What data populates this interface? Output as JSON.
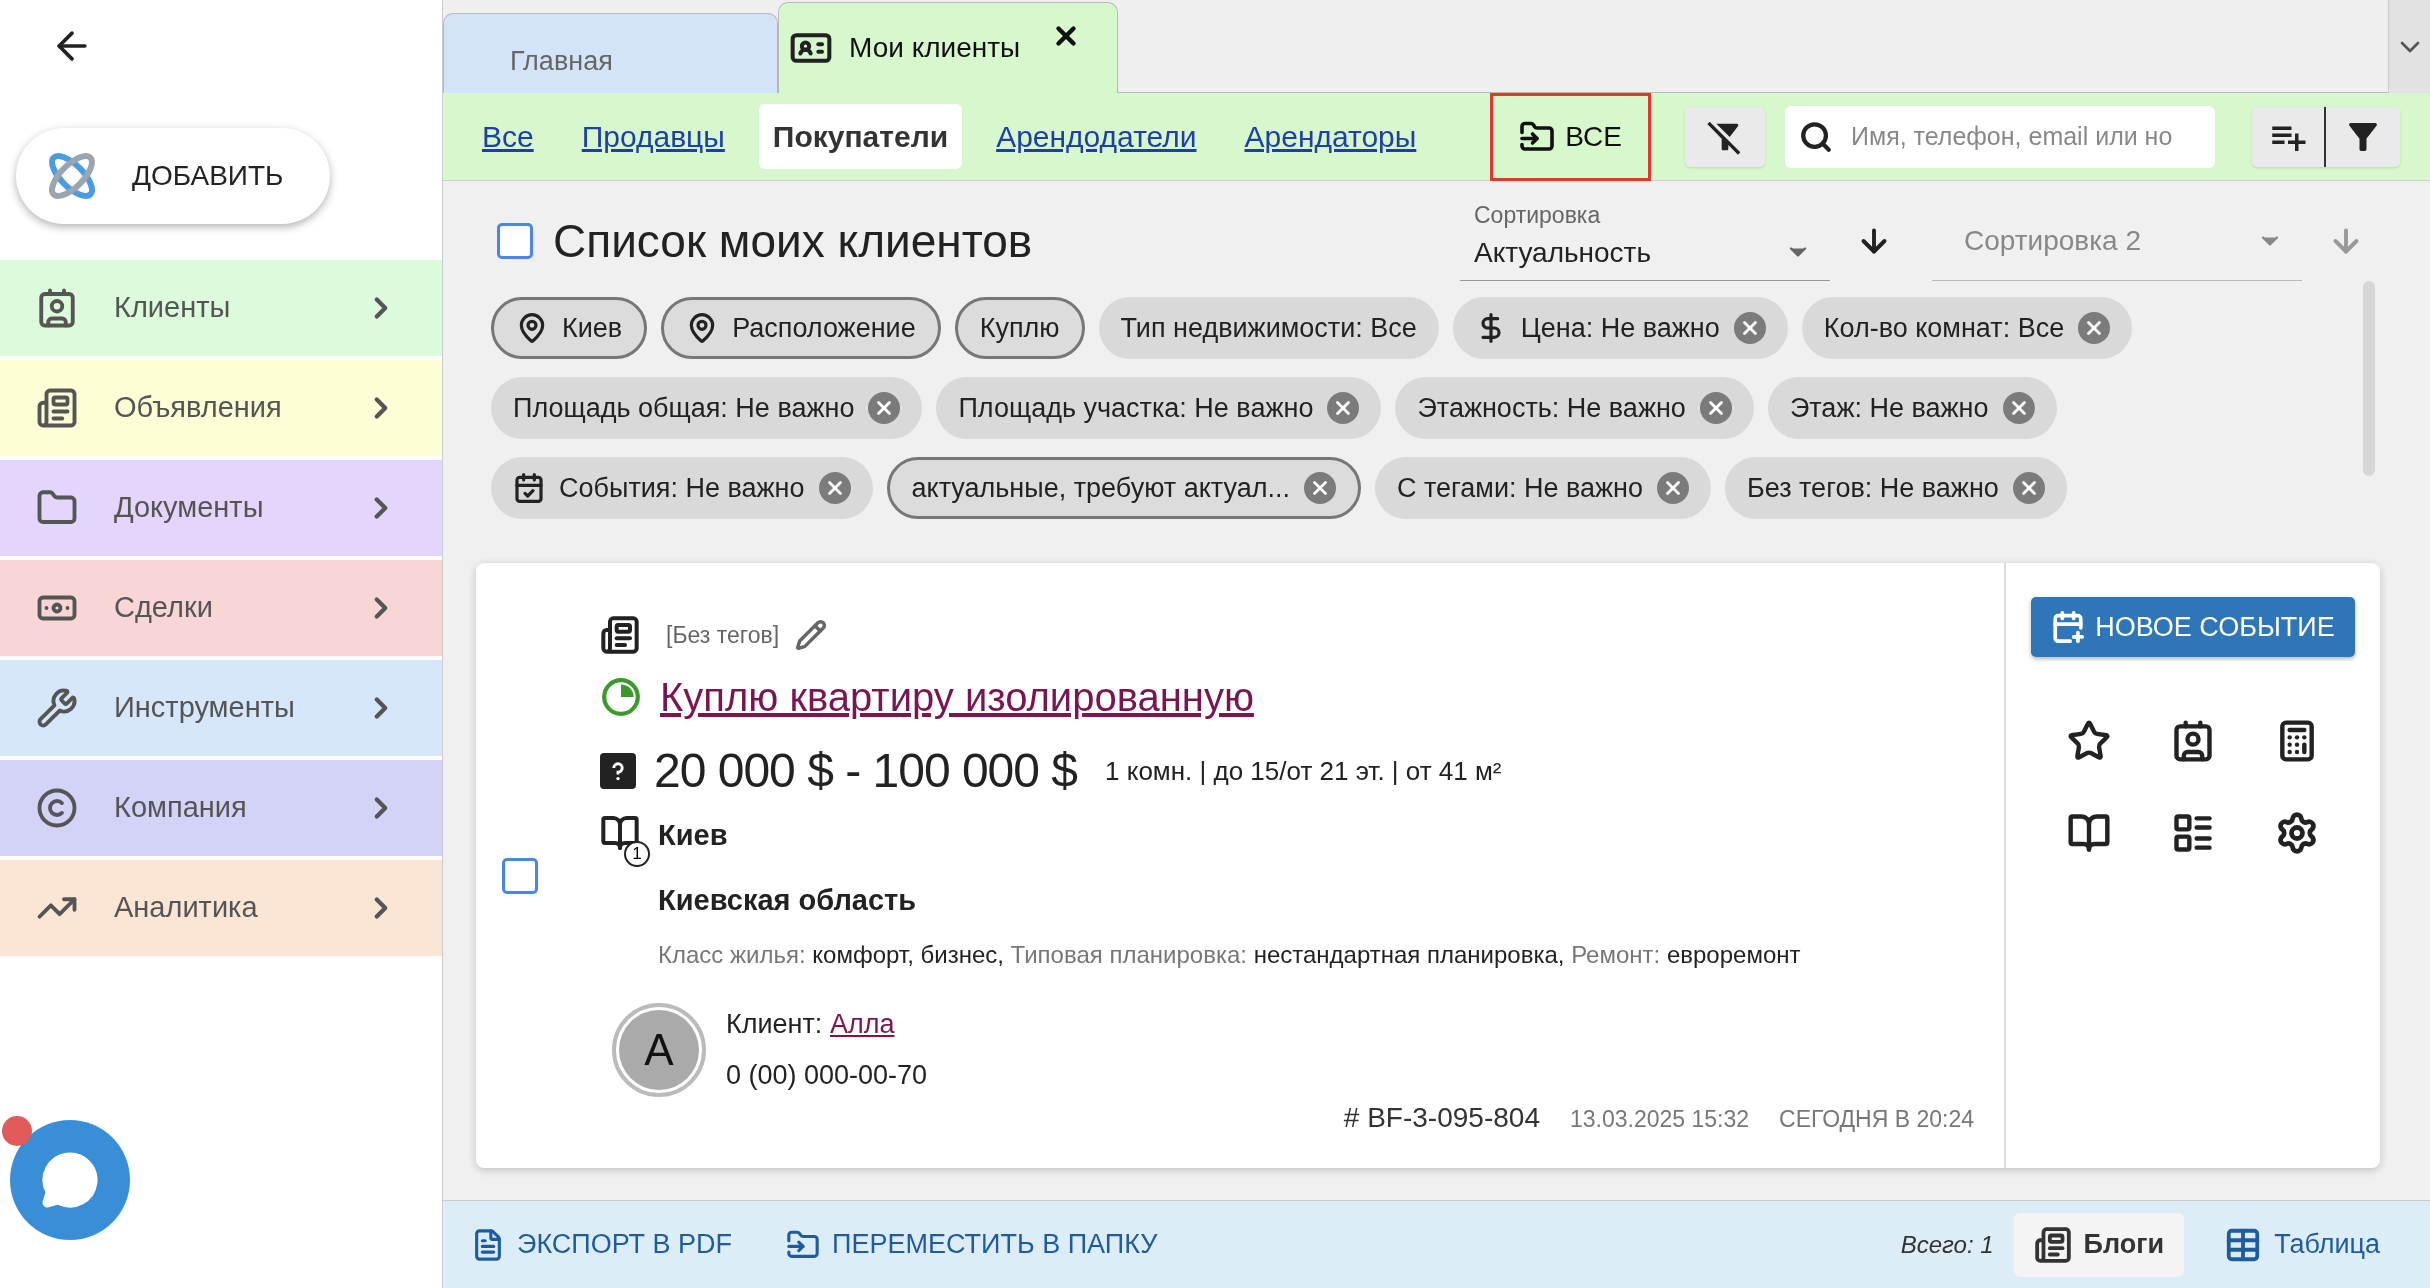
{
  "sidebar": {
    "add_button": "ДОБАВИТЬ",
    "items": [
      {
        "label": "Клиенты",
        "color": "#dcfadc",
        "kind": "clients"
      },
      {
        "label": "Объявления",
        "color": "#fdfdd6",
        "kind": "ads"
      },
      {
        "label": "Документы",
        "color": "#e3d5fb",
        "kind": "docs"
      },
      {
        "label": "Сделки",
        "color": "#f8d6d6",
        "kind": "deals"
      },
      {
        "label": "Инструменты",
        "color": "#d6e6fb",
        "kind": "tools"
      },
      {
        "label": "Компания",
        "color": "#d3d3f8",
        "kind": "company"
      },
      {
        "label": "Аналитика",
        "color": "#fbe6d6",
        "kind": "analytics"
      }
    ]
  },
  "tabs": [
    {
      "label": "Главная",
      "selected": false,
      "closable": false
    },
    {
      "label": "Мои клиенты",
      "selected": true,
      "closable": true
    }
  ],
  "filter_tabs": [
    {
      "label": "Все",
      "selected": false
    },
    {
      "label": "Продавцы",
      "selected": false
    },
    {
      "label": "Покупатели",
      "selected": true
    },
    {
      "label": "Арендодатели",
      "selected": false
    },
    {
      "label": "Арендаторы",
      "selected": false
    }
  ],
  "folder_button": "ВСЕ",
  "search": {
    "placeholder": "Имя, телефон, email или но"
  },
  "list": {
    "title": "Список моих клиентов",
    "checked": false,
    "sort": {
      "label": "Сортировка",
      "value": "Актуальность"
    },
    "sort2": {
      "placeholder": "Сортировка 2"
    }
  },
  "chips": [
    {
      "label": "Киев",
      "kind": "location",
      "outlined": true,
      "removable": false
    },
    {
      "label": "Расположение",
      "kind": "location",
      "outlined": true,
      "removable": false
    },
    {
      "label": "Куплю",
      "kind": "plain",
      "outlined": true,
      "removable": false
    },
    {
      "label": "Тип недвижимости: Все",
      "kind": "plain",
      "outlined": false,
      "removable": false
    },
    {
      "label": "Цена: Не важно",
      "kind": "price",
      "outlined": false,
      "removable": true
    },
    {
      "label": "Кол-во комнат: Все",
      "kind": "plain",
      "outlined": false,
      "removable": true
    },
    {
      "label": "Площадь общая: Не важно",
      "kind": "plain",
      "outlined": false,
      "removable": true
    },
    {
      "label": "Площадь участка: Не важно",
      "kind": "plain",
      "outlined": false,
      "removable": true
    },
    {
      "label": "Этажность: Не важно",
      "kind": "plain",
      "outlined": false,
      "removable": true
    },
    {
      "label": "Этаж: Не важно",
      "kind": "plain",
      "outlined": false,
      "removable": true
    },
    {
      "label": "События: Не важно",
      "kind": "events",
      "outlined": false,
      "removable": true
    },
    {
      "label": "актуальные, требуют актуал...",
      "kind": "plain",
      "outlined": true,
      "removable": true
    },
    {
      "label": "С тегами: Не важно",
      "kind": "plain",
      "outlined": false,
      "removable": true
    },
    {
      "label": "Без тегов: Не важно",
      "kind": "plain",
      "outlined": false,
      "removable": true
    }
  ],
  "card": {
    "checked": false,
    "tags": "[Без тегов]",
    "title": "Куплю квартиру изолированную",
    "price": "20 000 $ - 100 000 $",
    "summary": "1 комн. | до 15/от 21 эт. | от 41 м²",
    "count_badge": "1",
    "city": "Киев",
    "region": "Киевская область",
    "details": [
      {
        "label": "Класс жилья:",
        "value": "комфорт, бизнес,"
      },
      {
        "label": "Типовая планировка:",
        "value": "нестандартная планировка,"
      },
      {
        "label": "Ремонт:",
        "value": "евроремонт"
      }
    ],
    "client_label": "Клиент:",
    "client_name": "Алла",
    "avatar": "A",
    "phone": "0 (00) 000-00-70",
    "number": "# BF-3-095-804",
    "created": "13.03.2025 15:32",
    "updated": "СЕГОДНЯ В 20:24",
    "new_event": "НОВОЕ СОБЫТИЕ"
  },
  "bottom_bar": {
    "export": "ЭКСПОРТ В PDF",
    "move": "ПЕРЕМЕСТИТЬ В ПАПКУ",
    "total": "Всего: 1",
    "views": [
      {
        "label": "Блоги",
        "selected": true,
        "kind": "blogs"
      },
      {
        "label": "Таблица",
        "selected": false,
        "kind": "table"
      }
    ]
  }
}
